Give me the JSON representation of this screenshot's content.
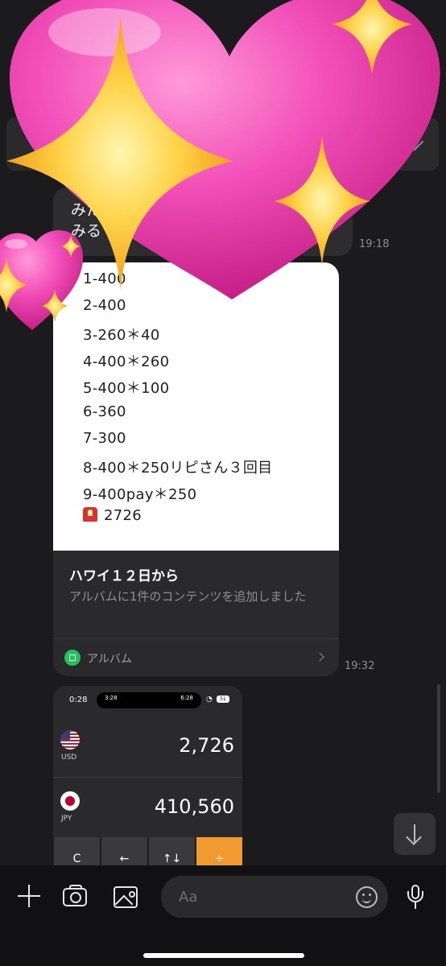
{
  "messages": {
    "prev_text": "みた\nみる",
    "prev_time": "19:18",
    "album_time": "19:32"
  },
  "note": {
    "lines": [
      "1-400",
      "2-400",
      "3-260＊40",
      "4-400＊260",
      "5-400＊100",
      "6-360",
      "7-300",
      "8-400＊250リピさん３回目",
      "9-400pay＊250"
    ],
    "total": "2726",
    "total_icon": "siren-icon"
  },
  "album": {
    "title": "ハワイ１２日から",
    "description": "アルバムに1件のコンテンツを追加しました",
    "link_label": "アルバム"
  },
  "screenshot": {
    "status_time": "0:28",
    "island_left": "3:28",
    "island_right": "6:28",
    "battery": "51",
    "rows": [
      {
        "code": "USD",
        "value": "2,726",
        "flag": "usa-flag-icon"
      },
      {
        "code": "JPY",
        "value": "410,560",
        "flag": "japan-flag-icon"
      }
    ],
    "keys": [
      "C",
      "←",
      "↑↓",
      "÷"
    ]
  },
  "input": {
    "placeholder": "Aa"
  },
  "colors": {
    "background": "#1b1b1d",
    "bubble": "#2d2d30",
    "accent_orange": "#f09a2f",
    "album_green": "#22c35a"
  },
  "decorations": [
    "heart-icon",
    "sparkle-icon"
  ]
}
